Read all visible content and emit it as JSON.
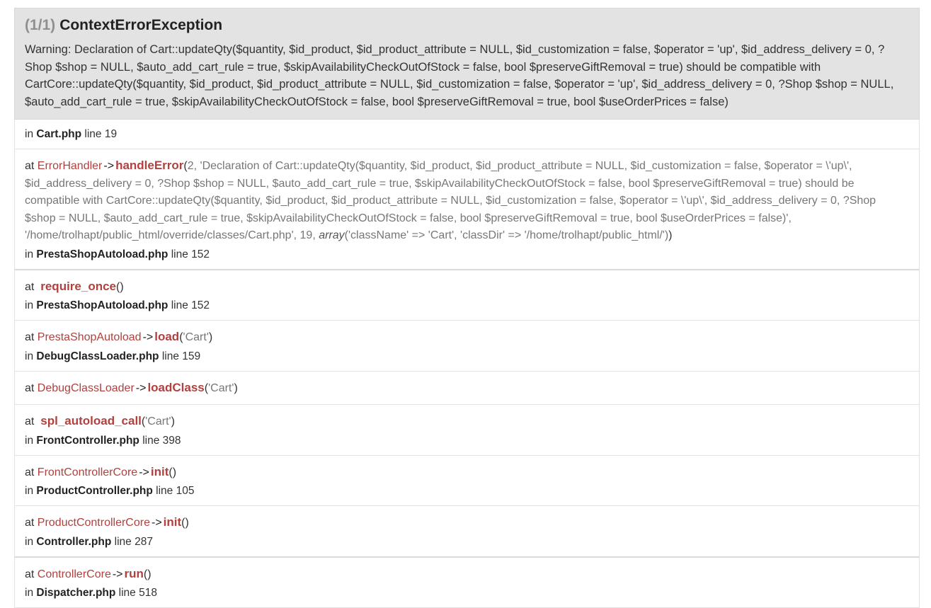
{
  "exception": {
    "count": "(1/1)",
    "name": "ContextErrorException",
    "message": "Warning: Declaration of Cart::updateQty($quantity, $id_product, $id_product_attribute = NULL, $id_customization = false, $operator = 'up', $id_address_delivery = 0, ?Shop $shop = NULL, $auto_add_cart_rule = true, $skipAvailabilityCheckOutOfStock = false, bool $preserveGiftRemoval = true) should be compatible with CartCore::updateQty($quantity, $id_product, $id_product_attribute = NULL, $id_customization = false, $operator = 'up', $id_address_delivery = 0, ?Shop $shop = NULL, $auto_add_cart_rule = true, $skipAvailabilityCheckOutOfStock = false, bool $preserveGiftRemoval = true, bool $useOrderPrices = false)"
  },
  "labels": {
    "at": "at",
    "in": "in",
    "line": "line",
    "arrow": "->",
    "open_paren": "(",
    "close_paren": ")"
  },
  "origin": {
    "file": "Cart.php",
    "line": "19"
  },
  "frames": [
    {
      "class": "ErrorHandler",
      "function": "handleError",
      "args_prefix": "2, 'Declaration of Cart::updateQty($quantity, $id_product, $id_product_attribute = NULL, $id_customization = false, $operator = \\'up\\', $id_address_delivery = 0, ?Shop $shop = NULL, $auto_add_cart_rule = true, $skipAvailabilityCheckOutOfStock = false, bool $preserveGiftRemoval = true) should be compatible with CartCore::updateQty($quantity, $id_product, $id_product_attribute = NULL, $id_customization = false, $operator = \\'up\\', $id_address_delivery = 0, ?Shop $shop = NULL, $auto_add_cart_rule = true, $skipAvailabilityCheckOutOfStock = false, bool $preserveGiftRemoval = true, bool $useOrderPrices = false)', '/home/trolhapt/public_html/override/classes/Cart.php', 19, ",
      "args_kw": "array",
      "args_suffix": "('className' => 'Cart', 'classDir' => '/home/trolhapt/public_html/')",
      "file": "PrestaShopAutoload.php",
      "line": "152"
    },
    {
      "function": "require_once",
      "args": "",
      "file": "PrestaShopAutoload.php",
      "line": "152"
    },
    {
      "class": "PrestaShopAutoload",
      "function": "load",
      "args": "'Cart'",
      "file": "DebugClassLoader.php",
      "line": "159"
    },
    {
      "class": "DebugClassLoader",
      "function": "loadClass",
      "args": "'Cart'"
    },
    {
      "function": "spl_autoload_call",
      "args": "'Cart'",
      "file": "FrontController.php",
      "line": "398"
    },
    {
      "class": "FrontControllerCore",
      "function": "init",
      "args": "",
      "file": "ProductController.php",
      "line": "105"
    },
    {
      "class": "ProductControllerCore",
      "function": "init",
      "args": "",
      "file": "Controller.php",
      "line": "287"
    },
    {
      "class": "ControllerCore",
      "function": "run",
      "args": "",
      "file": "Dispatcher.php",
      "line": "518"
    }
  ]
}
